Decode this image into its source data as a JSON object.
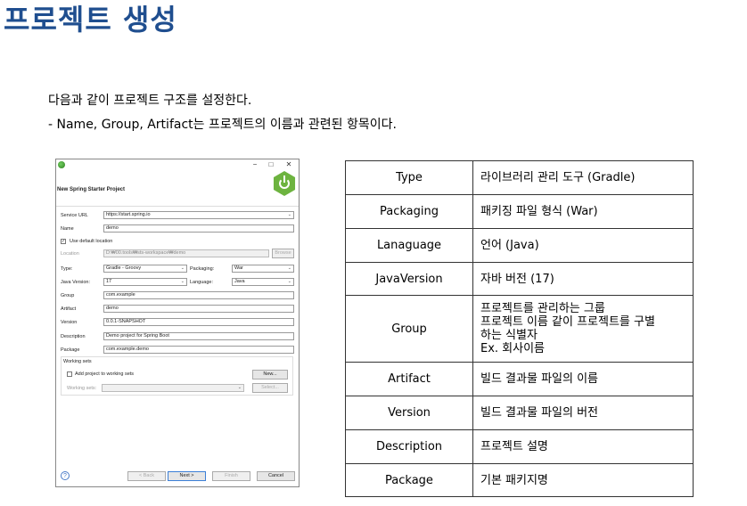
{
  "page": {
    "title": "프로젝트 생성",
    "intro_line1": "다음과 같이 프로젝트 구조를 설정한다.",
    "intro_line2": "- Name, Group, Artifact는 프로젝트의  이름과 관련된 항목이다."
  },
  "dialog": {
    "title": "New Spring Starter Project",
    "window_controls": {
      "minimize": "−",
      "maximize": "□",
      "close": "✕"
    },
    "service_url": {
      "label": "Service URL",
      "value": "https://start.spring.io"
    },
    "name": {
      "label": "Name",
      "value": "demo"
    },
    "use_default_location": {
      "label": "Use default location",
      "checked": true
    },
    "location": {
      "label": "Location",
      "value": "D:₩00.tools₩sts-workspace₩demo",
      "browse": "Browse"
    },
    "type": {
      "label": "Type:",
      "value": "Gradle - Groovy"
    },
    "packaging": {
      "label": "Packaging:",
      "value": "War"
    },
    "java_version": {
      "label": "Java Version:",
      "value": "17"
    },
    "language": {
      "label": "Language:",
      "value": "Java"
    },
    "group": {
      "label": "Group",
      "value": "com.example"
    },
    "artifact": {
      "label": "Artifact",
      "value": "demo"
    },
    "version": {
      "label": "Version",
      "value": "0.0.1-SNAPSHOT"
    },
    "description": {
      "label": "Description",
      "value": "Demo project for Spring Boot"
    },
    "package": {
      "label": "Package",
      "value": "com.example.demo"
    },
    "working_sets": {
      "label": "Working sets",
      "add_label": "Add project to working sets",
      "new_button": "New...",
      "sets_label": "Working sets:",
      "select_button": "Select..."
    },
    "footer": {
      "help": "?",
      "back": "< Back",
      "next": "Next >",
      "finish": "Finish",
      "cancel": "Cancel"
    }
  },
  "table": [
    {
      "key": "Type",
      "lines": [
        "라이브러리 관리 도구 (Gradle)"
      ]
    },
    {
      "key": "Packaging",
      "lines": [
        "패키징 파일 형식 (War)"
      ]
    },
    {
      "key": "Lanaguage",
      "lines": [
        "언어 (Java)"
      ]
    },
    {
      "key": "JavaVersion",
      "lines": [
        "자바 버전 (17)"
      ]
    },
    {
      "key": "Group",
      "lines": [
        "프로젝트를 관리하는 그룹",
        "프로젝트 이름 같이 프로젝트를 구별",
        "하는 식별자",
        "Ex. 회사이름"
      ]
    },
    {
      "key": "Artifact",
      "lines": [
        "빌드 결과물 파일의 이름"
      ]
    },
    {
      "key": "Version",
      "lines": [
        "빌드 결과물 파일의 버전"
      ]
    },
    {
      "key": "Description",
      "lines": [
        "프로젝트 설명"
      ]
    },
    {
      "key": "Package",
      "lines": [
        "기본 패키지명"
      ]
    }
  ]
}
